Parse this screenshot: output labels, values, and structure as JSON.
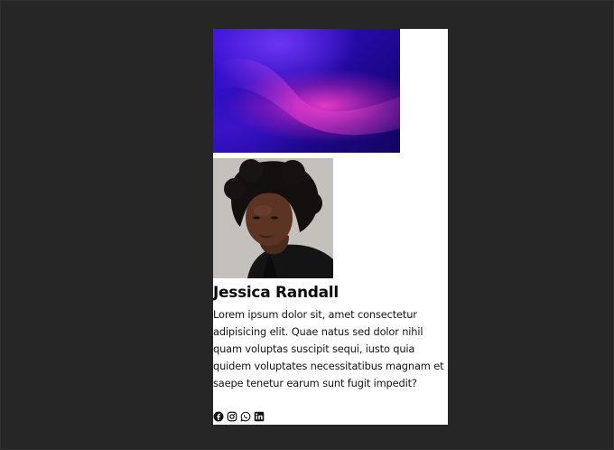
{
  "profile": {
    "name": "Jessica Randall",
    "bio": "Lorem ipsum dolor sit, amet consectetur adipisicing elit. Quae natus sed dolor nihil quam voluptas suscipit sequi, iusto quia quidem voluptates necessitatibus magnam et saepe tenetur earum sunt fugit impedit?"
  },
  "socials": [
    {
      "icon": "facebook-icon"
    },
    {
      "icon": "instagram-icon"
    },
    {
      "icon": "whatsapp-icon"
    },
    {
      "icon": "linkedin-icon"
    }
  ],
  "colors": {
    "background": "#262626",
    "card": "#ffffff",
    "text": "#0b0b0b",
    "banner_purple": "#3a12d8",
    "banner_pink": "#ee3cc8"
  }
}
